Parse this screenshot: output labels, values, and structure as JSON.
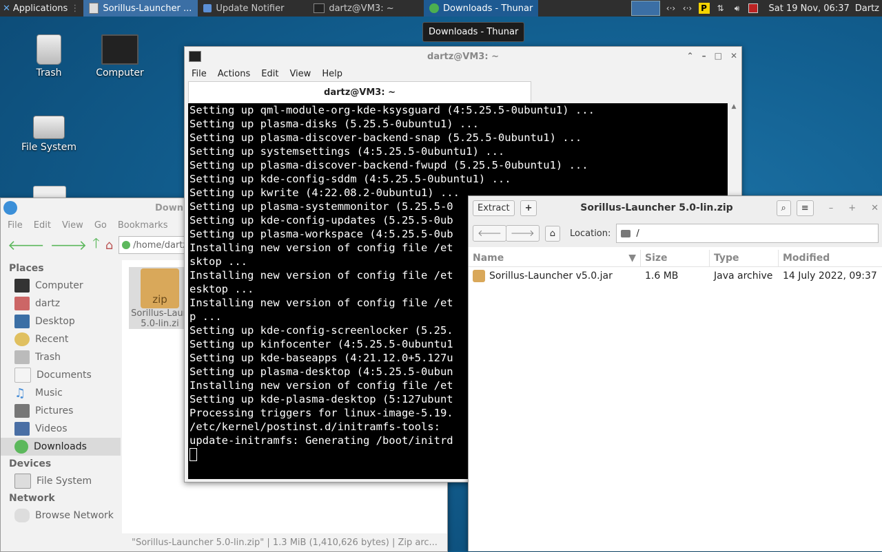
{
  "panel": {
    "applications_label": "Applications",
    "tasks": [
      {
        "label": "Sorillus-Launcher ...",
        "state": "active"
      },
      {
        "label": "Update Notifier",
        "state": ""
      },
      {
        "label": "dartz@VM3: ~",
        "state": ""
      },
      {
        "label": "Downloads - Thunar",
        "state": "sel"
      }
    ],
    "clock": "Sat 19 Nov, 06:37",
    "user": "Dartz"
  },
  "tooltip": "Downloads - Thunar",
  "desktop_icons": [
    {
      "label": "Trash"
    },
    {
      "label": "Computer"
    },
    {
      "label": "File System"
    }
  ],
  "terminal": {
    "title": "dartz@VM3: ~",
    "menu": [
      "File",
      "Actions",
      "Edit",
      "View",
      "Help"
    ],
    "tab_label": "dartz@VM3: ~",
    "lines": [
      "Setting up qml-module-org-kde-ksysguard (4:5.25.5-0ubuntu1) ...",
      "Setting up plasma-disks (5.25.5-0ubuntu1) ...",
      "Setting up plasma-discover-backend-snap (5.25.5-0ubuntu1) ...",
      "Setting up systemsettings (4:5.25.5-0ubuntu1) ...",
      "Setting up plasma-discover-backend-fwupd (5.25.5-0ubuntu1) ...",
      "Setting up kde-config-sddm (4:5.25.5-0ubuntu1) ...",
      "Setting up kwrite (4:22.08.2-0ubuntu1) ...",
      "Setting up plasma-systemmonitor (5.25.5-0",
      "Setting up kde-config-updates (5.25.5-0ub",
      "Setting up plasma-workspace (4:5.25.5-0ub",
      "Installing new version of config file /et",
      "sktop ...",
      "Installing new version of config file /et",
      "esktop ...",
      "Installing new version of config file /et",
      "p ...",
      "Setting up kde-config-screenlocker (5.25.",
      "Setting up kinfocenter (4:5.25.5-0ubuntu1",
      "Setting up kde-baseapps (4:21.12.0+5.127u",
      "Setting up plasma-desktop (4:5.25.5-0ubun",
      "Installing new version of config file /et",
      "Setting up kde-plasma-desktop (5:127ubunt",
      "Processing triggers for linux-image-5.19.",
      "/etc/kernel/postinst.d/initramfs-tools:",
      "update-initramfs: Generating /boot/initrd"
    ]
  },
  "thunar": {
    "title": "Downl",
    "menu": [
      "File",
      "Edit",
      "View",
      "Go",
      "Bookmarks"
    ],
    "location": "/home/dartz/Dow",
    "places_header": "Places",
    "places": [
      "Computer",
      "dartz",
      "Desktop",
      "Recent",
      "Trash",
      "Documents",
      "Music",
      "Pictures",
      "Videos",
      "Downloads"
    ],
    "devices_header": "Devices",
    "devices": [
      "File System"
    ],
    "network_header": "Network",
    "network": [
      "Browse Network"
    ],
    "file_label_line1": "Sorillus-Laun",
    "file_label_line2": "5.0-lin.zi",
    "file_badge": "zip",
    "status": "\"Sorillus-Launcher 5.0-lin.zip\" | 1.3 MiB (1,410,626 bytes) | Zip arc..."
  },
  "archive": {
    "extract_label": "Extract",
    "add_label": "+",
    "title": "Sorillus-Launcher 5.0-lin.zip",
    "location_label": "Location:",
    "location_value": "/",
    "columns": [
      "Name",
      "Size",
      "Type",
      "Modified"
    ],
    "rows": [
      {
        "name": "Sorillus-Launcher v5.0.jar",
        "size": "1.6 MB",
        "type": "Java archive",
        "modified": "14 July 2022, 09:37"
      }
    ]
  }
}
